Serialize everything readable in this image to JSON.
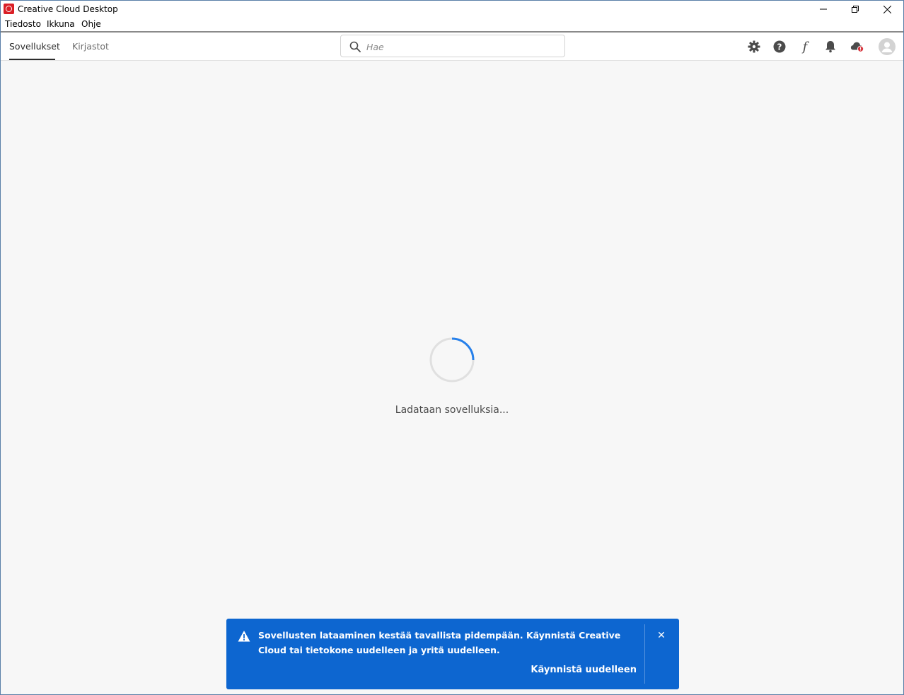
{
  "window": {
    "title": "Creative Cloud Desktop",
    "minimize": "—",
    "maximize": "❐",
    "close": "✕"
  },
  "menubar": {
    "items": [
      "Tiedosto",
      "Ikkuna",
      "Ohje"
    ]
  },
  "header": {
    "tabs": [
      {
        "label": "Sovellukset",
        "active": true
      },
      {
        "label": "Kirjastot",
        "active": false
      }
    ],
    "search_placeholder": "Hae",
    "icons": [
      "gear-icon",
      "help-icon",
      "fonts-icon",
      "bell-icon",
      "cloud-alert-icon",
      "avatar-icon"
    ]
  },
  "main": {
    "loading_text": "Ladataan sovelluksia..."
  },
  "toast": {
    "message": "Sovellusten lataaminen kestää tavallista pidempään. Käynnistä Creative Cloud tai tietokone uudelleen ja yritä uudelleen.",
    "action": "Käynnistä uudelleen",
    "close": "✕",
    "color": "#0d66d0"
  }
}
